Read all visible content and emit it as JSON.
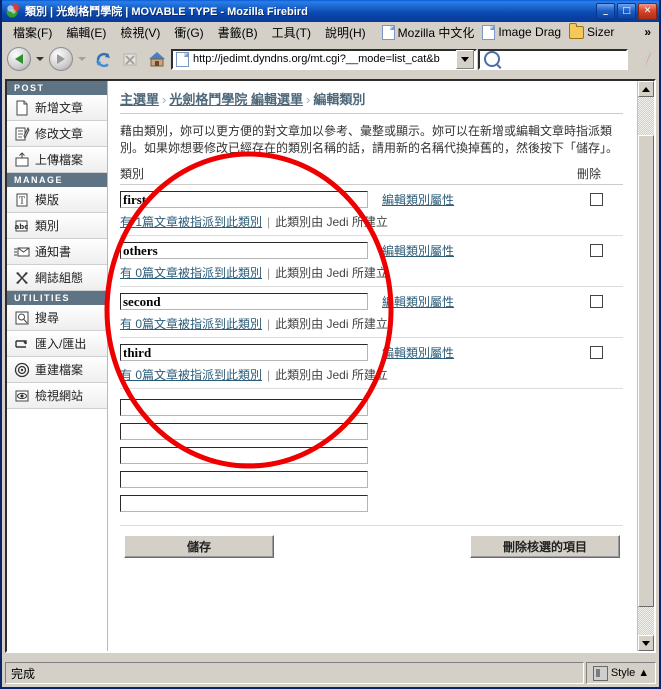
{
  "window": {
    "title": "類別 | 光劍格鬥學院 | MOVABLE TYPE - Mozilla Firebird",
    "icon": "firebird-icon",
    "minimize_label": "_",
    "maximize_label": "□",
    "close_label": "✕"
  },
  "menubar": {
    "items": [
      {
        "label": "檔案(F)",
        "name": "file"
      },
      {
        "label": "編輯(E)",
        "name": "edit"
      },
      {
        "label": "檢視(V)",
        "name": "view"
      },
      {
        "label": "衝(G)",
        "name": "go"
      },
      {
        "label": "書籤(B)",
        "name": "bookmarks"
      },
      {
        "label": "工具(T)",
        "name": "tools"
      },
      {
        "label": "說明(H)",
        "name": "help"
      }
    ],
    "bookmarks": [
      {
        "label": "Mozilla 中文化",
        "icon": "document-icon"
      },
      {
        "label": "Image Drag",
        "icon": "document-icon"
      },
      {
        "label": "Sizer",
        "icon": "folder-icon"
      }
    ],
    "overflow_label": "»"
  },
  "navbar": {
    "back_icon": "back-arrow-icon",
    "forward_icon": "forward-arrow-icon",
    "reload_icon": "reload-icon",
    "stop_icon": "stop-icon",
    "home_icon": "home-icon",
    "url": "http://jedimt.dyndns.org/mt.cgi?__mode=list_cat&b",
    "url_placeholder": "",
    "search_value": "",
    "search_placeholder": "",
    "search_icon": "magnifier-icon",
    "brand_icon": "firebird-logo-icon"
  },
  "sidebar": {
    "sections": [
      {
        "heading": "POST",
        "items": [
          {
            "label": "新增文章",
            "icon": "new-document-icon"
          },
          {
            "label": "修改文章",
            "icon": "edit-document-icon"
          },
          {
            "label": "上傳檔案",
            "icon": "upload-file-icon"
          }
        ]
      },
      {
        "heading": "MANAGE",
        "items": [
          {
            "label": "模版",
            "icon": "template-icon"
          },
          {
            "label": "類別",
            "icon": "category-icon"
          },
          {
            "label": "通知書",
            "icon": "notification-icon"
          },
          {
            "label": "網誌組態",
            "icon": "blog-config-icon"
          }
        ]
      },
      {
        "heading": "UTILITIES",
        "items": [
          {
            "label": "搜尋",
            "icon": "search-icon"
          },
          {
            "label": "匯入/匯出",
            "icon": "import-export-icon"
          },
          {
            "label": "重建檔案",
            "icon": "rebuild-icon"
          },
          {
            "label": "檢視網站",
            "icon": "view-site-icon"
          }
        ]
      }
    ]
  },
  "main": {
    "breadcrumb": {
      "items": [
        "主選單",
        "光劍格鬥學院 編輯選單",
        "編輯類別"
      ],
      "separator": "›"
    },
    "intro": "藉由類別，妳可以更方便的對文章加以參考、彙整或顯示。妳可以在新增或編輯文章時指派類別。如果妳想要修改已經存在的類別名稱的話，請用新的名稱代換掉舊的，然後按下「儲存」。",
    "table_header": {
      "left": "類別",
      "right": "刪除"
    },
    "categories": [
      {
        "name": "first",
        "edit_link": "編輯類別屬性",
        "count_link": "有 1篇文章被指派到此類別",
        "separator": "|",
        "author_note": "此類別由 Jedi 所建立",
        "delete_checked": false
      },
      {
        "name": "others",
        "edit_link": "編輯類別屬性",
        "count_link": "有 0篇文章被指派到此類別",
        "separator": "|",
        "author_note": "此類別由 Jedi 所建立",
        "delete_checked": false
      },
      {
        "name": "second",
        "edit_link": "編輯類別屬性",
        "count_link": "有 0篇文章被指派到此類別",
        "separator": "|",
        "author_note": "此類別由 Jedi 所建立",
        "delete_checked": false
      },
      {
        "name": "third",
        "edit_link": "編輯類別屬性",
        "count_link": "有 0篇文章被指派到此類別",
        "separator": "|",
        "author_note": "此類別由 Jedi 所建立",
        "delete_checked": false
      }
    ],
    "new_category_inputs": [
      "",
      "",
      "",
      "",
      ""
    ],
    "new_category_placeholder": "",
    "buttons": {
      "save": "儲存",
      "delete": "刪除核選的項目"
    }
  },
  "statusbar": {
    "message": "完成",
    "style_label": "Style",
    "style_caret": "▲",
    "style_icon": "style-switcher-icon"
  },
  "annotation": {
    "shape": "red-oval",
    "color": "#ee0000"
  }
}
